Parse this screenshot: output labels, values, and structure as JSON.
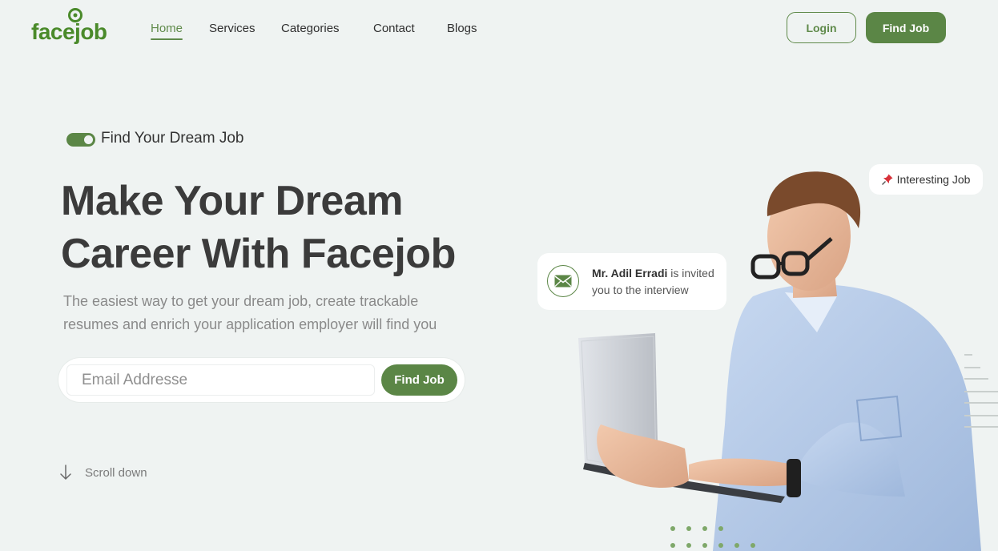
{
  "nav": {
    "logo": "facejob",
    "links": [
      "Home",
      "Services",
      "Categories",
      "Contact",
      "Blogs"
    ],
    "active": "Home",
    "login_label": "Login",
    "find_job_label": "Find Job"
  },
  "hero": {
    "eyebrow": "Find Your Dream Job",
    "headline_line1": "Make Your Dream",
    "headline_line2": "Career With Facejob",
    "subtext_line1": "The easiest way to get your dream job, create trackable",
    "subtext_line2": "resumes and enrich your application employer will find you",
    "search": {
      "placeholder": "Email Addresse",
      "value": "",
      "button_label": "Find Job"
    },
    "scroll_label": "Scroll down"
  },
  "notification": {
    "name": "Mr. Adil Erradi",
    "message": "is invited you to the interview"
  },
  "badge": {
    "icon": "pushpin-icon",
    "label": "Interesting Job"
  },
  "colors": {
    "accent": "#5b8646",
    "background": "#eff3f2",
    "heading": "#3b3b3b"
  }
}
